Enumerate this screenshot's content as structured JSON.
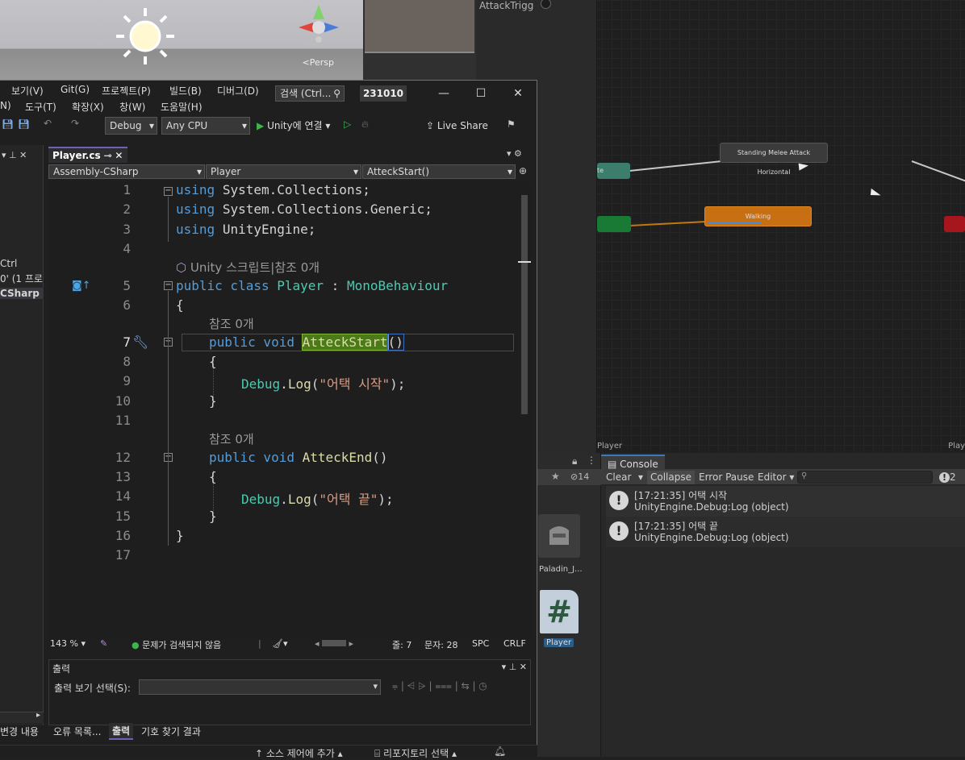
{
  "scene": {
    "persp": "<Persp"
  },
  "animator": {
    "trigger_param": "AttackTrigg",
    "nodes": {
      "melee": "Standing Melee Attack Horizontal",
      "walking": "Walking",
      "left_node": "te"
    },
    "footer_left": "Player",
    "footer_right": "Play"
  },
  "vs": {
    "menu_row1": [
      "보기(V)",
      "Git(G)",
      "프로젝트(P)",
      "빌드(B)",
      "디버그(D)"
    ],
    "menu_row2": [
      "N)",
      "도구(T)",
      "확장(X)",
      "창(W)",
      "도움말(H)"
    ],
    "search": "검색 (Ctrl...",
    "solution_badge": "231010",
    "config": "Debug",
    "platform": "Any CPU",
    "run": "Unity에 연결",
    "live_share": "Live Share",
    "tab": "Player.cs",
    "nav": {
      "project": "Assembly-CSharp",
      "class": "Player",
      "member": "AtteckStart()"
    },
    "side": {
      "ctrl": "Ctrl",
      "proj": "0' (1 프로",
      "csharp": "CSharp"
    },
    "code": {
      "l1": "using System.Collections;",
      "l2": "using System.Collections.Generic;",
      "l3": "using UnityEngine;",
      "lens_unity": "Unity 스크립트|참조 0개",
      "l5a": "public class ",
      "l5b": "Player",
      "l5c": " : ",
      "l5d": "MonoBehaviour",
      "l6": "{",
      "lens_ref": "참조 0개",
      "l7a": "public void ",
      "l7b": "AtteckStart",
      "l7c": "()",
      "l8": "{",
      "l9a": "Debug",
      ".": ".",
      "l9b": "Log",
      "l9c": "(",
      "l9d": "\"어택 시작\"",
      "l9e": ");",
      "l10": "}",
      "l12a": "public void ",
      "l12b": "AtteckEnd",
      "l12c": "()",
      "l13": "{",
      "l14d": "\"어택 끝\"",
      "l15": "}",
      "l16": "}"
    },
    "line_numbers": [
      "1",
      "2",
      "3",
      "4",
      "5",
      "6",
      "7",
      "8",
      "9",
      "10",
      "11",
      "12",
      "13",
      "14",
      "15",
      "16",
      "17"
    ],
    "status": {
      "zoom": "143 %",
      "issues": "문제가 검색되지 않음",
      "line": "줄: 7",
      "col": "문자: 28",
      "spc": "SPC",
      "crlf": "CRLF"
    },
    "output": {
      "title": "출력",
      "label": "출력 보기 선택(S):"
    },
    "bottom_tabs": [
      "변경 내용",
      "오류 목록...",
      "출력",
      "기호 찾기 결과"
    ],
    "footer": {
      "source": "소스 제어에 추가",
      "repo": "리포지토리 선택"
    }
  },
  "project": {
    "badge": "14",
    "asset1": "Paladin_J...",
    "asset2": "Player"
  },
  "console": {
    "tab": "Console",
    "clear": "Clear",
    "collapse": "Collapse",
    "error_pause": "Error Pause",
    "editor": "Editor",
    "count": "2",
    "logs": [
      {
        "t1": "[17:21:35] 어택 시작",
        "t2": "UnityEngine.Debug:Log (object)"
      },
      {
        "t1": "[17:21:35] 어택 끝",
        "t2": "UnityEngine.Debug:Log (object)"
      }
    ]
  }
}
